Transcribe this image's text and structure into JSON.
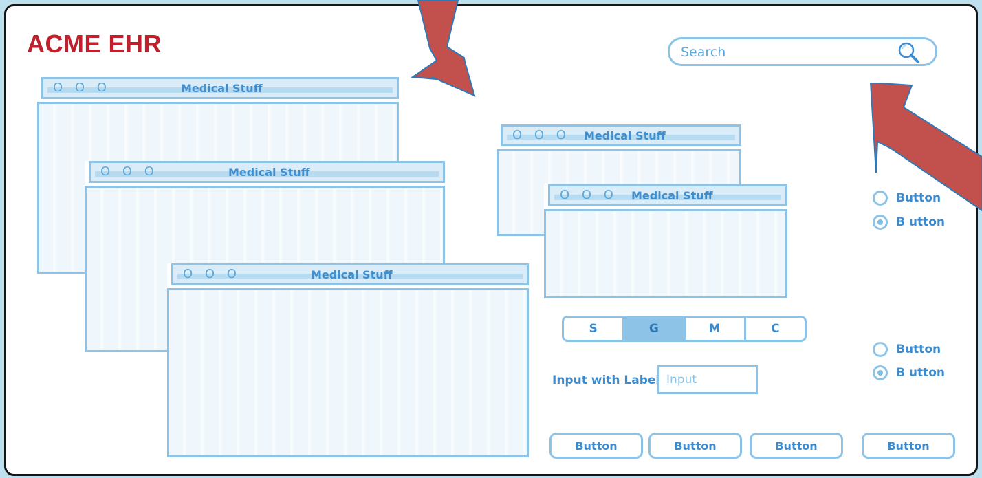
{
  "app": {
    "brand": "ACME EHR"
  },
  "search": {
    "placeholder": "Search"
  },
  "windows": {
    "title": "Medical Stuff",
    "dots": "O O O"
  },
  "radio_groups": [
    {
      "items": [
        {
          "label": "Button",
          "checked": false
        },
        {
          "label": "B utton",
          "checked": true
        }
      ]
    },
    {
      "items": [
        {
          "label": "Button",
          "checked": false
        },
        {
          "label": "B utton",
          "checked": true
        }
      ]
    }
  ],
  "segmented": {
    "items": [
      "S",
      "G",
      "M",
      "C"
    ],
    "selected": "G"
  },
  "form": {
    "label": "Input with Label:",
    "input_placeholder": "Input"
  },
  "buttons": [
    "Button",
    "Button",
    "Button",
    "Button"
  ],
  "colors": {
    "brand": "#c0202b",
    "sketch_blue": "#8cc3e6",
    "text_blue": "#3a8bcf",
    "arrow_red": "#c2504c"
  }
}
